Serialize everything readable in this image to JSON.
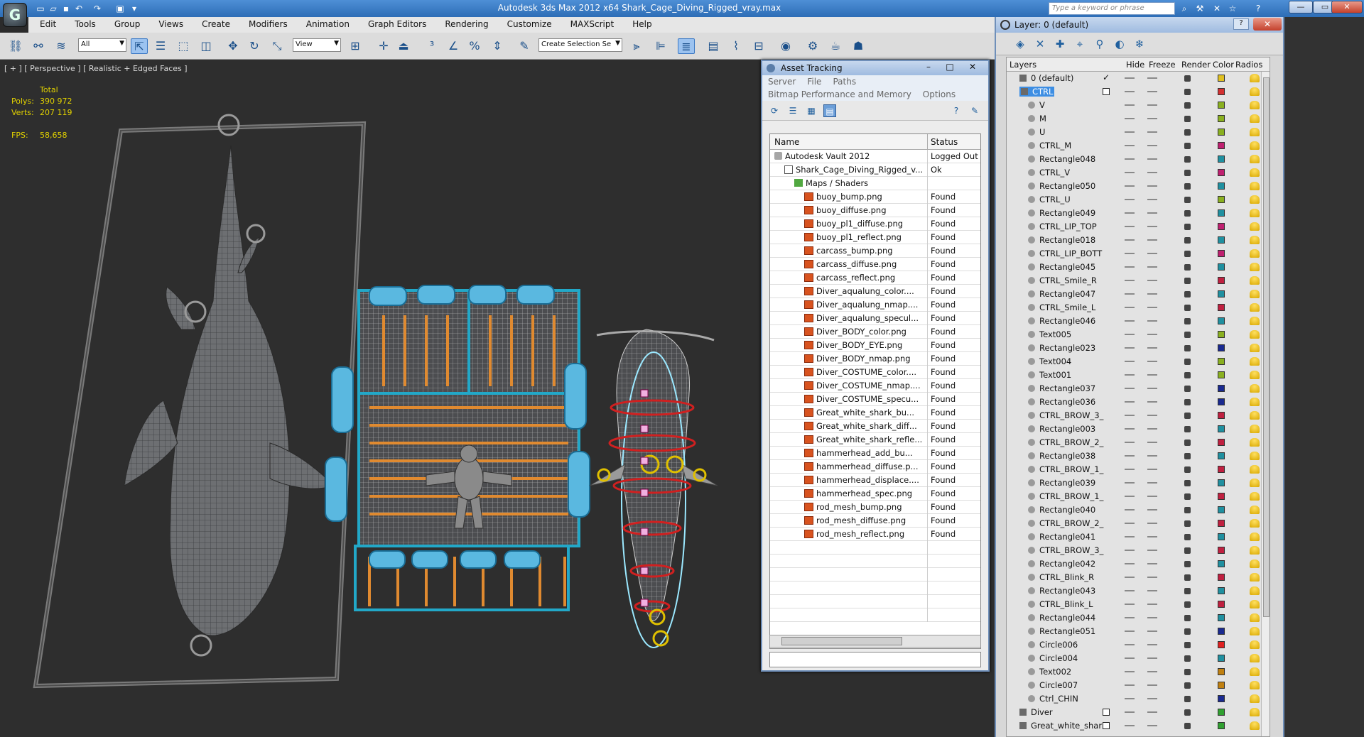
{
  "window": {
    "title": "Autodesk 3ds Max  2012 x64      Shark_Cage_Diving_Rigged_vray.max",
    "search_placeholder": "Type a keyword or phrase",
    "logo_glyph": "G"
  },
  "menu": [
    "Edit",
    "Tools",
    "Group",
    "Views",
    "Create",
    "Modifiers",
    "Animation",
    "Graph Editors",
    "Rendering",
    "Customize",
    "MAXScript",
    "Help"
  ],
  "toolbar": {
    "selection_filter": "All",
    "ref_coord": "View",
    "named_selection": "Create Selection Se"
  },
  "viewport": {
    "label": "[ + ] [ Perspective ] [ Realistic + Edged Faces ]",
    "stats": {
      "total_label": "Total",
      "polys_label": "Polys:",
      "polys_value": "390 972",
      "verts_label": "Verts:",
      "verts_value": "207 119",
      "fps_label": "FPS:",
      "fps_value": "58,658"
    }
  },
  "asset_tracking": {
    "title": "Asset Tracking",
    "menu1": [
      "Server",
      "File",
      "Paths"
    ],
    "menu2": [
      "Bitmap Performance and Memory",
      "Options"
    ],
    "col_name": "Name",
    "col_status": "Status",
    "rows": [
      {
        "name": "Autodesk Vault 2012",
        "status": "Logged Out ...",
        "indent": 0,
        "icon": "vault"
      },
      {
        "name": "Shark_Cage_Diving_Rigged_v...",
        "status": "Ok",
        "indent": 1,
        "icon": "file"
      },
      {
        "name": "Maps / Shaders",
        "status": "",
        "indent": 2,
        "icon": "maps"
      },
      {
        "name": "buoy_bump.png",
        "status": "Found",
        "indent": 3,
        "icon": "img"
      },
      {
        "name": "buoy_diffuse.png",
        "status": "Found",
        "indent": 3,
        "icon": "img"
      },
      {
        "name": "buoy_pl1_diffuse.png",
        "status": "Found",
        "indent": 3,
        "icon": "img"
      },
      {
        "name": "buoy_pl1_reflect.png",
        "status": "Found",
        "indent": 3,
        "icon": "img"
      },
      {
        "name": "carcass_bump.png",
        "status": "Found",
        "indent": 3,
        "icon": "img"
      },
      {
        "name": "carcass_diffuse.png",
        "status": "Found",
        "indent": 3,
        "icon": "img"
      },
      {
        "name": "carcass_reflect.png",
        "status": "Found",
        "indent": 3,
        "icon": "img"
      },
      {
        "name": "Diver_aqualung_color....",
        "status": "Found",
        "indent": 3,
        "icon": "img"
      },
      {
        "name": "Diver_aqualung_nmap....",
        "status": "Found",
        "indent": 3,
        "icon": "img"
      },
      {
        "name": "Diver_aqualung_specul...",
        "status": "Found",
        "indent": 3,
        "icon": "img"
      },
      {
        "name": "Diver_BODY_color.png",
        "status": "Found",
        "indent": 3,
        "icon": "img"
      },
      {
        "name": "Diver_BODY_EYE.png",
        "status": "Found",
        "indent": 3,
        "icon": "img"
      },
      {
        "name": "Diver_BODY_nmap.png",
        "status": "Found",
        "indent": 3,
        "icon": "img"
      },
      {
        "name": "Diver_COSTUME_color....",
        "status": "Found",
        "indent": 3,
        "icon": "img"
      },
      {
        "name": "Diver_COSTUME_nmap....",
        "status": "Found",
        "indent": 3,
        "icon": "img"
      },
      {
        "name": "Diver_COSTUME_specu...",
        "status": "Found",
        "indent": 3,
        "icon": "img"
      },
      {
        "name": "Great_white_shark_bu...",
        "status": "Found",
        "indent": 3,
        "icon": "img"
      },
      {
        "name": "Great_white_shark_diff...",
        "status": "Found",
        "indent": 3,
        "icon": "img"
      },
      {
        "name": "Great_white_shark_refle...",
        "status": "Found",
        "indent": 3,
        "icon": "img"
      },
      {
        "name": "hammerhead_add_bu...",
        "status": "Found",
        "indent": 3,
        "icon": "img"
      },
      {
        "name": "hammerhead_diffuse.p...",
        "status": "Found",
        "indent": 3,
        "icon": "img"
      },
      {
        "name": "hammerhead_displace....",
        "status": "Found",
        "indent": 3,
        "icon": "img"
      },
      {
        "name": "hammerhead_spec.png",
        "status": "Found",
        "indent": 3,
        "icon": "img"
      },
      {
        "name": "rod_mesh_bump.png",
        "status": "Found",
        "indent": 3,
        "icon": "img"
      },
      {
        "name": "rod_mesh_diffuse.png",
        "status": "Found",
        "indent": 3,
        "icon": "img"
      },
      {
        "name": "rod_mesh_reflect.png",
        "status": "Found",
        "indent": 3,
        "icon": "img"
      }
    ]
  },
  "layer_manager": {
    "title": "Layer: 0 (default)",
    "help": "?",
    "close": "✕",
    "cols": {
      "layers": "Layers",
      "hide": "Hide",
      "freeze": "Freeze",
      "render": "Render",
      "color": "Color",
      "radios": "Radios"
    },
    "rows": [
      {
        "name": "0 (default)",
        "level": 0,
        "type": "layer",
        "color": "#e0c020",
        "mark": "tick"
      },
      {
        "name": "CTRL",
        "level": 0,
        "type": "layer",
        "color": "#d43030",
        "mark": "box",
        "selected": true
      },
      {
        "name": "V",
        "level": 1,
        "type": "obj",
        "color": "#8ab020"
      },
      {
        "name": "M",
        "level": 1,
        "type": "obj",
        "color": "#8ab020"
      },
      {
        "name": "U",
        "level": 1,
        "type": "obj",
        "color": "#8ab020"
      },
      {
        "name": "CTRL_M",
        "level": 1,
        "type": "obj",
        "color": "#c02070"
      },
      {
        "name": "Rectangle048",
        "level": 1,
        "type": "obj",
        "color": "#2090a0"
      },
      {
        "name": "CTRL_V",
        "level": 1,
        "type": "obj",
        "color": "#c02070"
      },
      {
        "name": "Rectangle050",
        "level": 1,
        "type": "obj",
        "color": "#2090a0"
      },
      {
        "name": "CTRL_U",
        "level": 1,
        "type": "obj",
        "color": "#8ab020"
      },
      {
        "name": "Rectangle049",
        "level": 1,
        "type": "obj",
        "color": "#2090a0"
      },
      {
        "name": "CTRL_LIP_TOP",
        "level": 1,
        "type": "obj",
        "color": "#c02070"
      },
      {
        "name": "Rectangle018",
        "level": 1,
        "type": "obj",
        "color": "#2090a0"
      },
      {
        "name": "CTRL_LIP_BOTT",
        "level": 1,
        "type": "obj",
        "color": "#c02070"
      },
      {
        "name": "Rectangle045",
        "level": 1,
        "type": "obj",
        "color": "#2090a0"
      },
      {
        "name": "CTRL_Smile_R",
        "level": 1,
        "type": "obj",
        "color": "#c02040"
      },
      {
        "name": "Rectangle047",
        "level": 1,
        "type": "obj",
        "color": "#2090a0"
      },
      {
        "name": "CTRL_Smile_L",
        "level": 1,
        "type": "obj",
        "color": "#c02040"
      },
      {
        "name": "Rectangle046",
        "level": 1,
        "type": "obj",
        "color": "#2090a0"
      },
      {
        "name": "Text005",
        "level": 1,
        "type": "obj",
        "color": "#8ab020"
      },
      {
        "name": "Rectangle023",
        "level": 1,
        "type": "obj",
        "color": "#1a2a90"
      },
      {
        "name": "Text004",
        "level": 1,
        "type": "obj",
        "color": "#8ab020"
      },
      {
        "name": "Text001",
        "level": 1,
        "type": "obj",
        "color": "#8ab020"
      },
      {
        "name": "Rectangle037",
        "level": 1,
        "type": "obj",
        "color": "#1a2a90"
      },
      {
        "name": "Rectangle036",
        "level": 1,
        "type": "obj",
        "color": "#1a2a90"
      },
      {
        "name": "CTRL_BROW_3_",
        "level": 1,
        "type": "obj",
        "color": "#c02040"
      },
      {
        "name": "Rectangle003",
        "level": 1,
        "type": "obj",
        "color": "#2090a0"
      },
      {
        "name": "CTRL_BROW_2_",
        "level": 1,
        "type": "obj",
        "color": "#c02040"
      },
      {
        "name": "Rectangle038",
        "level": 1,
        "type": "obj",
        "color": "#2090a0"
      },
      {
        "name": "CTRL_BROW_1_",
        "level": 1,
        "type": "obj",
        "color": "#c02040"
      },
      {
        "name": "Rectangle039",
        "level": 1,
        "type": "obj",
        "color": "#2090a0"
      },
      {
        "name": "CTRL_BROW_1_",
        "level": 1,
        "type": "obj",
        "color": "#c02040"
      },
      {
        "name": "Rectangle040",
        "level": 1,
        "type": "obj",
        "color": "#2090a0"
      },
      {
        "name": "CTRL_BROW_2_",
        "level": 1,
        "type": "obj",
        "color": "#c02040"
      },
      {
        "name": "Rectangle041",
        "level": 1,
        "type": "obj",
        "color": "#2090a0"
      },
      {
        "name": "CTRL_BROW_3_",
        "level": 1,
        "type": "obj",
        "color": "#c02040"
      },
      {
        "name": "Rectangle042",
        "level": 1,
        "type": "obj",
        "color": "#2090a0"
      },
      {
        "name": "CTRL_Blink_R",
        "level": 1,
        "type": "obj",
        "color": "#c02040"
      },
      {
        "name": "Rectangle043",
        "level": 1,
        "type": "obj",
        "color": "#2090a0"
      },
      {
        "name": "CTRL_Blink_L",
        "level": 1,
        "type": "obj",
        "color": "#c02040"
      },
      {
        "name": "Rectangle044",
        "level": 1,
        "type": "obj",
        "color": "#2090a0"
      },
      {
        "name": "Rectangle051",
        "level": 1,
        "type": "obj",
        "color": "#1a2a90"
      },
      {
        "name": "Circle006",
        "level": 1,
        "type": "obj",
        "color": "#e02020"
      },
      {
        "name": "Circle004",
        "level": 1,
        "type": "obj",
        "color": "#2090a0"
      },
      {
        "name": "Text002",
        "level": 1,
        "type": "obj",
        "color": "#c08010"
      },
      {
        "name": "Circle007",
        "level": 1,
        "type": "obj",
        "color": "#c08010"
      },
      {
        "name": "Ctrl_CHIN",
        "level": 1,
        "type": "obj",
        "color": "#1a2a90"
      },
      {
        "name": "Diver",
        "level": 0,
        "type": "layer",
        "color": "#30a030",
        "mark": "box"
      },
      {
        "name": "Great_white_shark",
        "level": 0,
        "type": "layer",
        "color": "#30a030",
        "mark": "box"
      }
    ]
  }
}
